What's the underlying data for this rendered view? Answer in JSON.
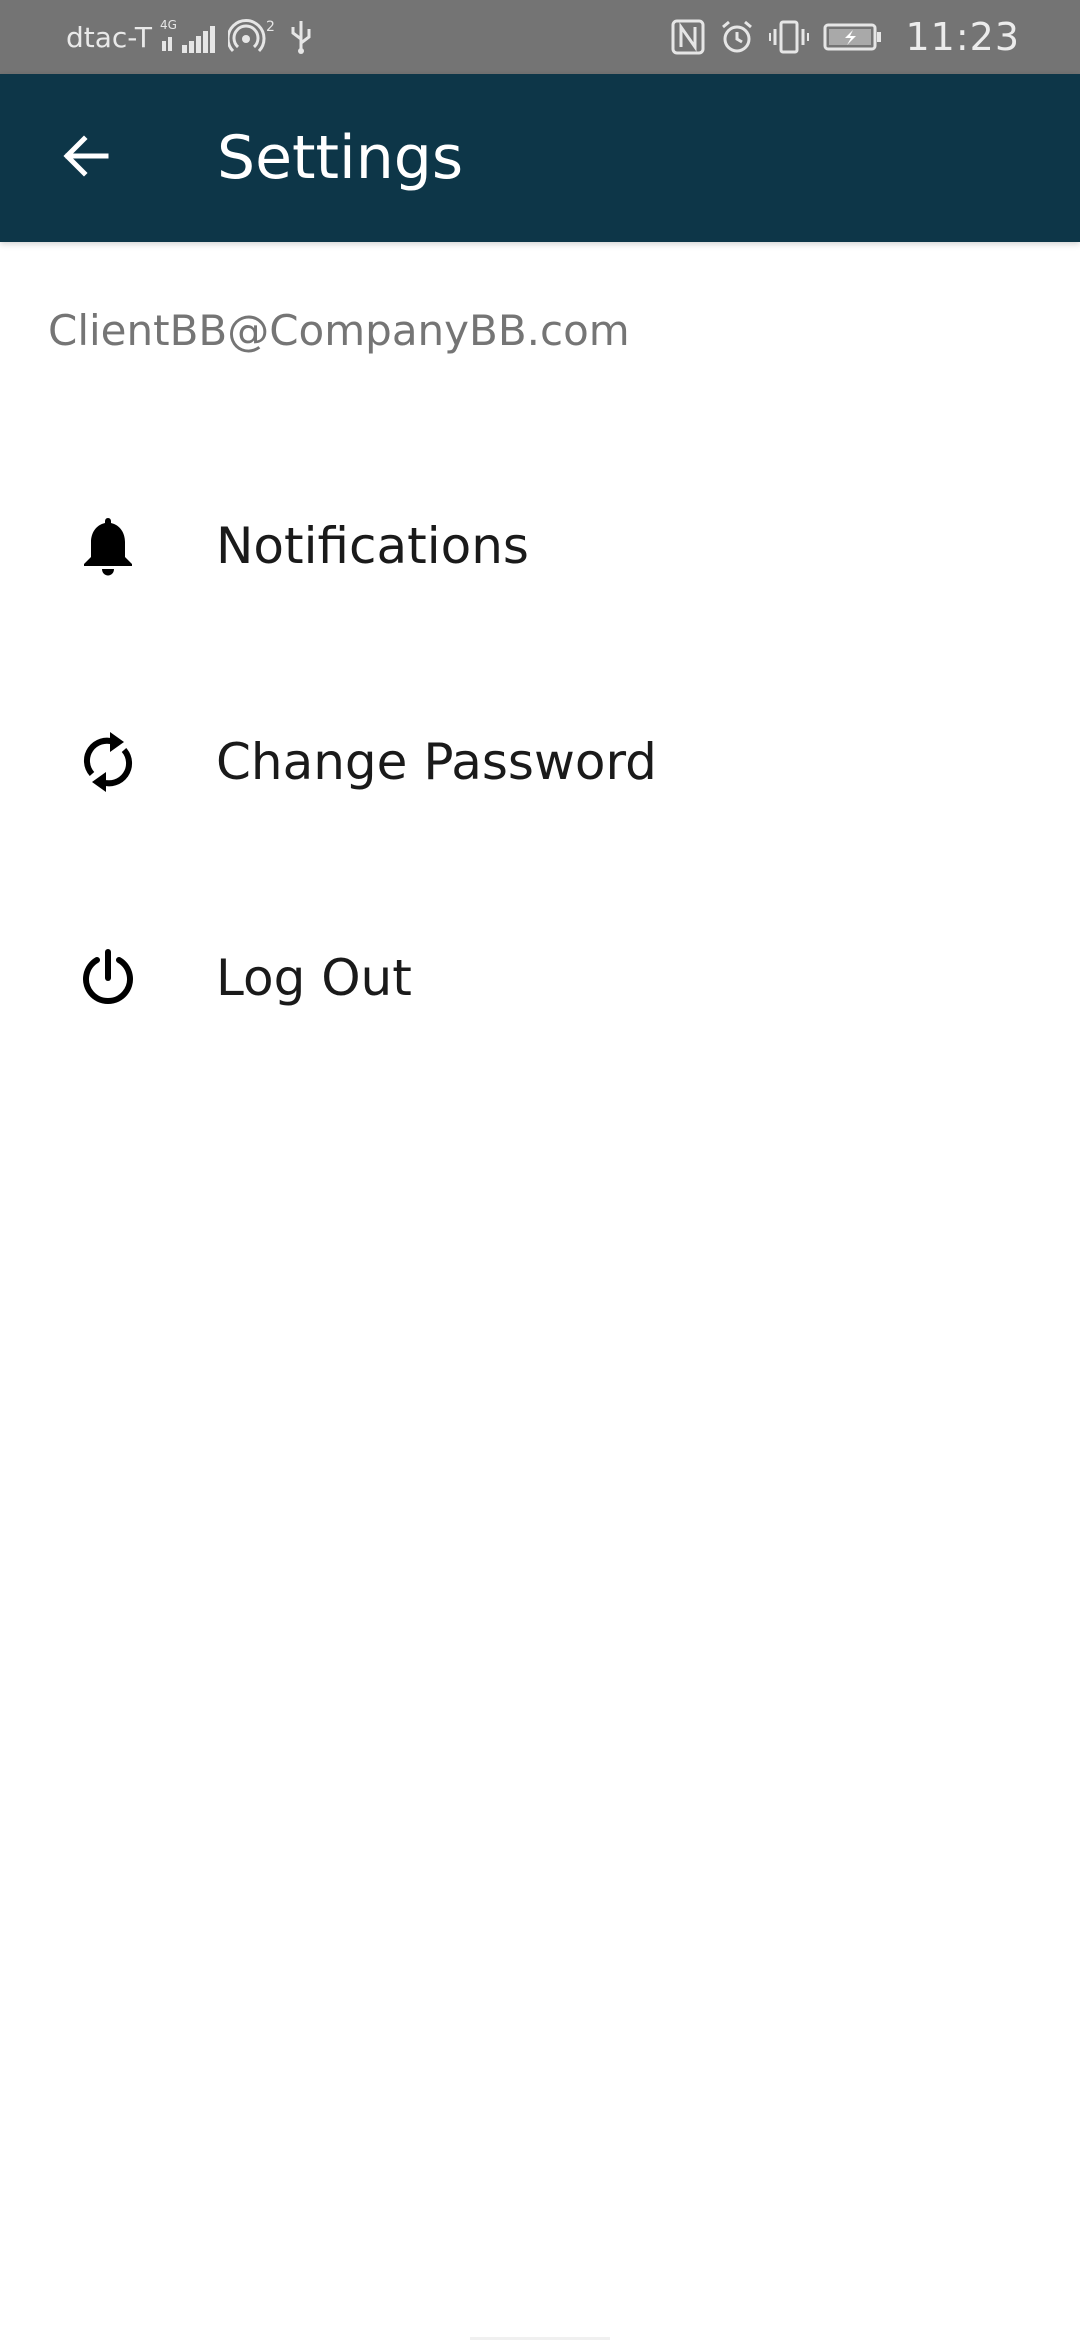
{
  "status_bar": {
    "carrier": "dtac-T",
    "network": "4G",
    "hotspot_count": "2",
    "time": "11:23",
    "icons": [
      "signal-icon",
      "hotspot-icon",
      "usb-icon",
      "nfc-icon",
      "alarm-icon",
      "vibrate-icon",
      "battery-charging-icon"
    ]
  },
  "app_bar": {
    "back_icon": "arrow-left-icon",
    "title": "Settings"
  },
  "account": {
    "email": "ClientBB@CompanyBB.com"
  },
  "settings": {
    "items": [
      {
        "label": "Notifications",
        "icon": "bell-icon"
      },
      {
        "label": "Change Password",
        "icon": "refresh-icon"
      },
      {
        "label": "Log Out",
        "icon": "power-icon"
      }
    ]
  },
  "colors": {
    "status_bar": "#747474",
    "app_bar": "#0d3648",
    "title": "#ffffff",
    "email": "#757575",
    "item_text": "#1a1a1a"
  }
}
